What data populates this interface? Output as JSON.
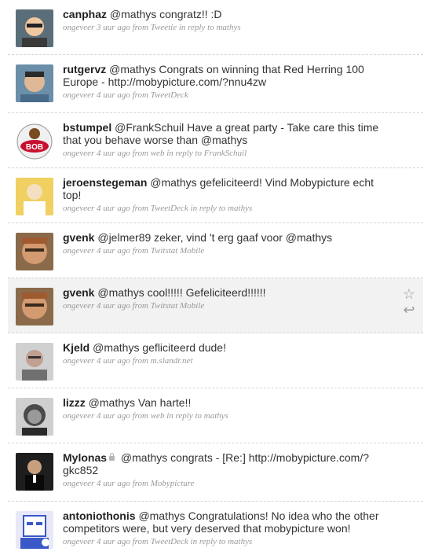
{
  "tweets": [
    {
      "user": "canphaz",
      "text": "@mathys congratz!! :D",
      "time": "ongeveer 3 uur ago",
      "from_label": "from",
      "source": "Tweetie",
      "reply_label": "in reply to",
      "reply_to": "mathys",
      "avatar_bg": "#5a6e7a",
      "avatar_fg": "#f0c8a0"
    },
    {
      "user": "rutgervz",
      "text": "@mathys Congrats on winning that Red Herring 100 Europe - http://mobypicture.com/?nnu4zw",
      "time": "ongeveer 4 uur ago",
      "from_label": "from",
      "source": "TweetDeck",
      "reply_label": "",
      "reply_to": "",
      "avatar_bg": "#6b8fa8",
      "avatar_fg": "#e0b896"
    },
    {
      "user": "bstumpel",
      "text": "@FrankSchuil Have a great party - Take care this time that you behave worse than @mathys",
      "time": "ongeveer 4 uur ago",
      "from_label": "from",
      "source": "web",
      "reply_label": "in reply to",
      "reply_to": "FrankSchuil",
      "avatar_bg": "#ffffff",
      "avatar_fg": "#c8102e"
    },
    {
      "user": "jeroenstegeman",
      "text": "@mathys gefeliciteerd! Vind Mobypicture echt top!",
      "time": "ongeveer 4 uur ago",
      "from_label": "from",
      "source": "TweetDeck",
      "reply_label": "in reply to",
      "reply_to": "mathys",
      "avatar_bg": "#f0d060",
      "avatar_fg": "#f4e0c0"
    },
    {
      "user": "gvenk",
      "text": "@jelmer89 zeker, vind 't erg gaaf voor @mathys",
      "time": "ongeveer 4 uur ago",
      "from_label": "from",
      "source": "Twitstat Mobile",
      "reply_label": "",
      "reply_to": "",
      "avatar_bg": "#8a6a4a",
      "avatar_fg": "#d49a70"
    },
    {
      "user": "gvenk",
      "text": "@mathys cool!!!!! Gefeliciteerd!!!!!!",
      "time": "ongeveer 4 uur ago",
      "from_label": "from",
      "source": "Twitstat Mobile",
      "reply_label": "",
      "reply_to": "",
      "avatar_bg": "#8a6a4a",
      "avatar_fg": "#d49a70"
    },
    {
      "user": "Kjeld",
      "text": "@mathys gefliciteerd dude!",
      "time": "ongeveer 4 uur ago",
      "from_label": "from",
      "source": "m.slandr.net",
      "reply_label": "",
      "reply_to": "",
      "avatar_bg": "#d0d0d0",
      "avatar_fg": "#c0a090"
    },
    {
      "user": "lizzz",
      "text": "@mathys Van harte!!",
      "time": "ongeveer 4 uur ago",
      "from_label": "from",
      "source": "web",
      "reply_label": "in reply to",
      "reply_to": "mathys",
      "avatar_bg": "#cfcfcf",
      "avatar_fg": "#4a4a4a"
    },
    {
      "user": "Mylonas",
      "text": "@mathys congrats - [Re:] http://mobypicture.com/?gkc852",
      "time": "ongeveer 4 uur ago",
      "from_label": "from",
      "source": "Mobypicture",
      "reply_label": "",
      "reply_to": "",
      "avatar_bg": "#1e1e1e",
      "avatar_fg": "#c8a080"
    },
    {
      "user": "antoniothonis",
      "text": "@mathys Congratulations! No idea who the other competitors were, but very deserved that mobypicture won!",
      "time": "ongeveer 4 uur ago",
      "from_label": "from",
      "source": "TweetDeck",
      "reply_label": "in reply to",
      "reply_to": "mathys",
      "avatar_bg": "#e8e8f8",
      "avatar_fg": "#3a58c8"
    }
  ],
  "actions": {
    "favorite_icon": "star-icon",
    "reply_icon": "reply-icon",
    "favorite_glyph": "☆",
    "reply_glyph": "↩"
  }
}
